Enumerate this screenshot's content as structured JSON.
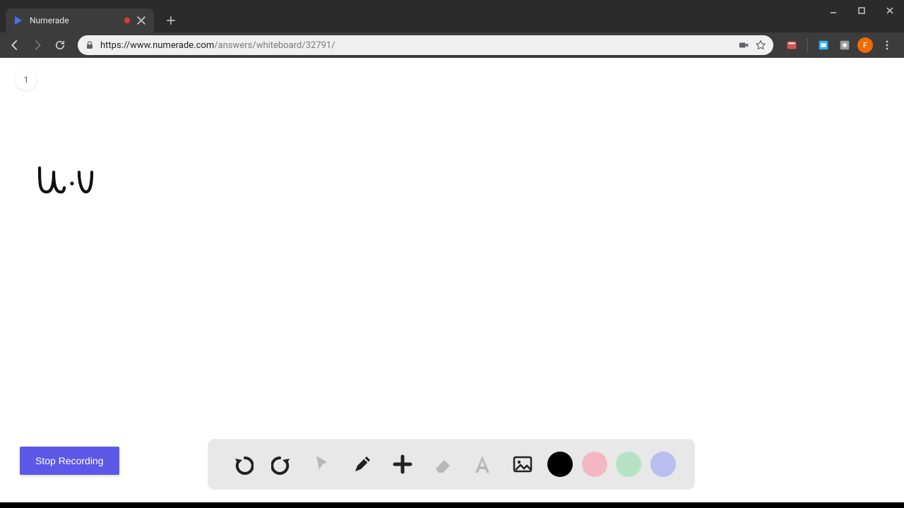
{
  "browser": {
    "tab_title": "Numerade",
    "url_scheme": "https://",
    "url_host": "www.numerade.com",
    "url_path": "/answers/whiteboard/32791/",
    "avatar_letter": "F"
  },
  "whiteboard": {
    "page_number": "1",
    "handwriting_label": "u·v"
  },
  "recording": {
    "stop_label": "Stop Recording"
  },
  "toolbar": {
    "undo": "Undo",
    "redo": "Redo",
    "pointer": "Pointer",
    "pencil": "Pencil",
    "add": "Add",
    "eraser": "Eraser",
    "text": "Text",
    "image": "Image"
  },
  "colors": {
    "black": "#000000",
    "pink": "#f3b7c2",
    "green": "#b6e2c4",
    "violet": "#b9bdf0"
  }
}
